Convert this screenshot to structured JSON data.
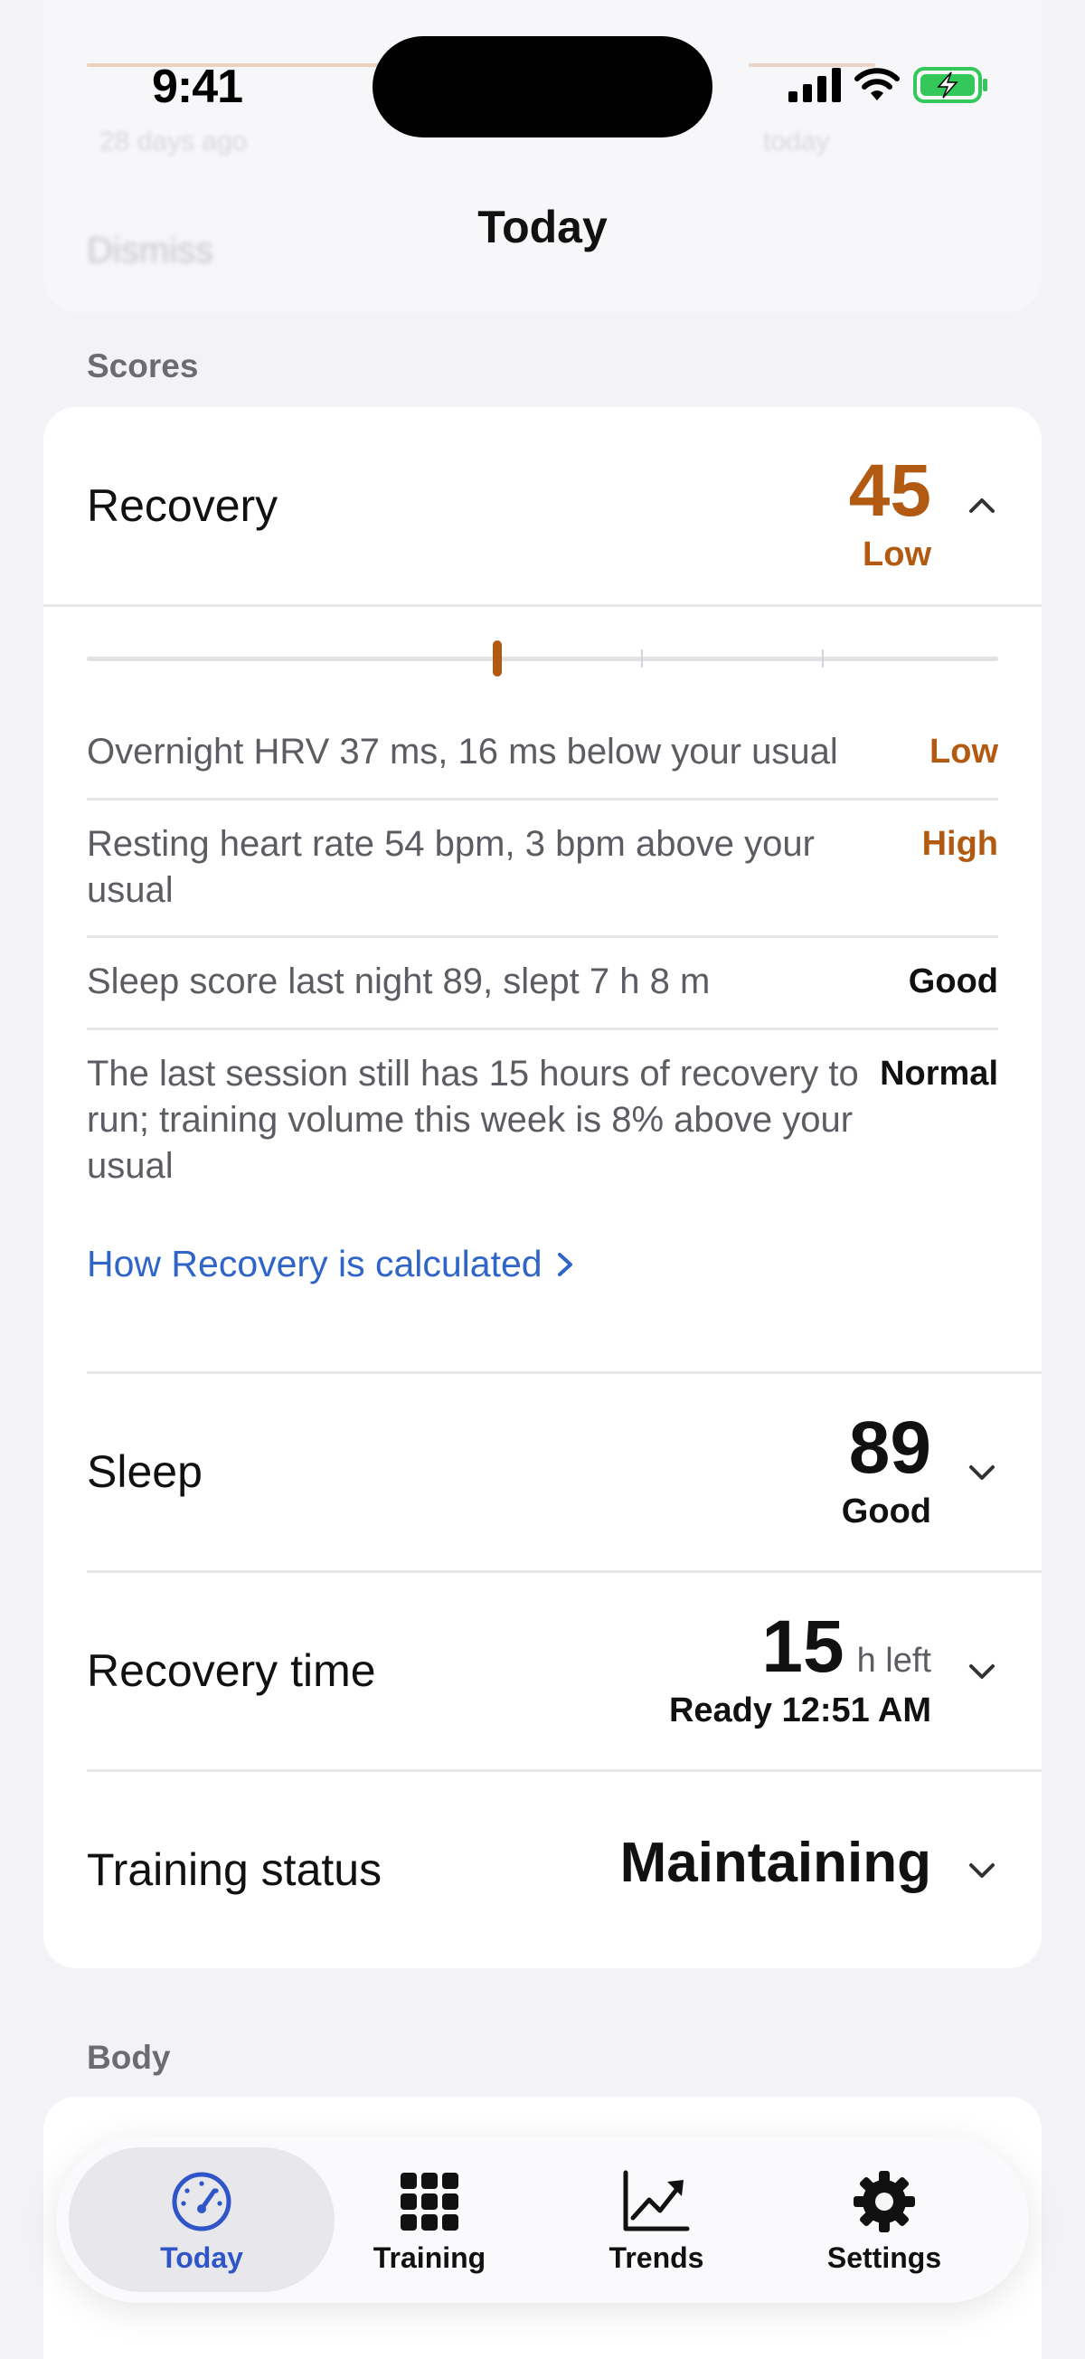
{
  "status_bar": {
    "time": "9:41"
  },
  "ghost": {
    "left_caption": "28 days ago",
    "right_caption": "today",
    "dismiss": "Dismiss"
  },
  "page": {
    "title": "Today"
  },
  "sections": {
    "scores": "Scores",
    "body": "Body"
  },
  "recovery": {
    "title": "Recovery",
    "score": "45",
    "score_label": "Low",
    "gauge_fraction": 0.45,
    "factors": [
      {
        "text": "Overnight HRV 37 ms, 16 ms below your usual",
        "status": "Low"
      },
      {
        "text": "Resting heart rate 54 bpm, 3 bpm above your usual",
        "status": "High"
      },
      {
        "text": "Sleep score last night 89, slept 7 h 8 m",
        "status": "Good"
      },
      {
        "text": "The last session still has 15 hours of recovery to run; training volume this week is 8% above your usual",
        "status": "Normal"
      }
    ],
    "link": "How Recovery is calculated"
  },
  "sleep": {
    "title": "Sleep",
    "score": "89",
    "label": "Good"
  },
  "recovery_time": {
    "title": "Recovery time",
    "value": "15",
    "unit": "h left",
    "ready": "Ready 12:51 AM"
  },
  "training_status": {
    "title": "Training status",
    "value": "Maintaining"
  },
  "colors": {
    "accent_orange": "#b35a12",
    "link_blue": "#2f64c8",
    "active_tab": "#2f55c8"
  },
  "tabs": [
    {
      "label": "Today",
      "icon": "gauge-icon",
      "active": true
    },
    {
      "label": "Training",
      "icon": "grid-icon",
      "active": false
    },
    {
      "label": "Trends",
      "icon": "chart-icon",
      "active": false
    },
    {
      "label": "Settings",
      "icon": "gear-icon",
      "active": false
    }
  ]
}
